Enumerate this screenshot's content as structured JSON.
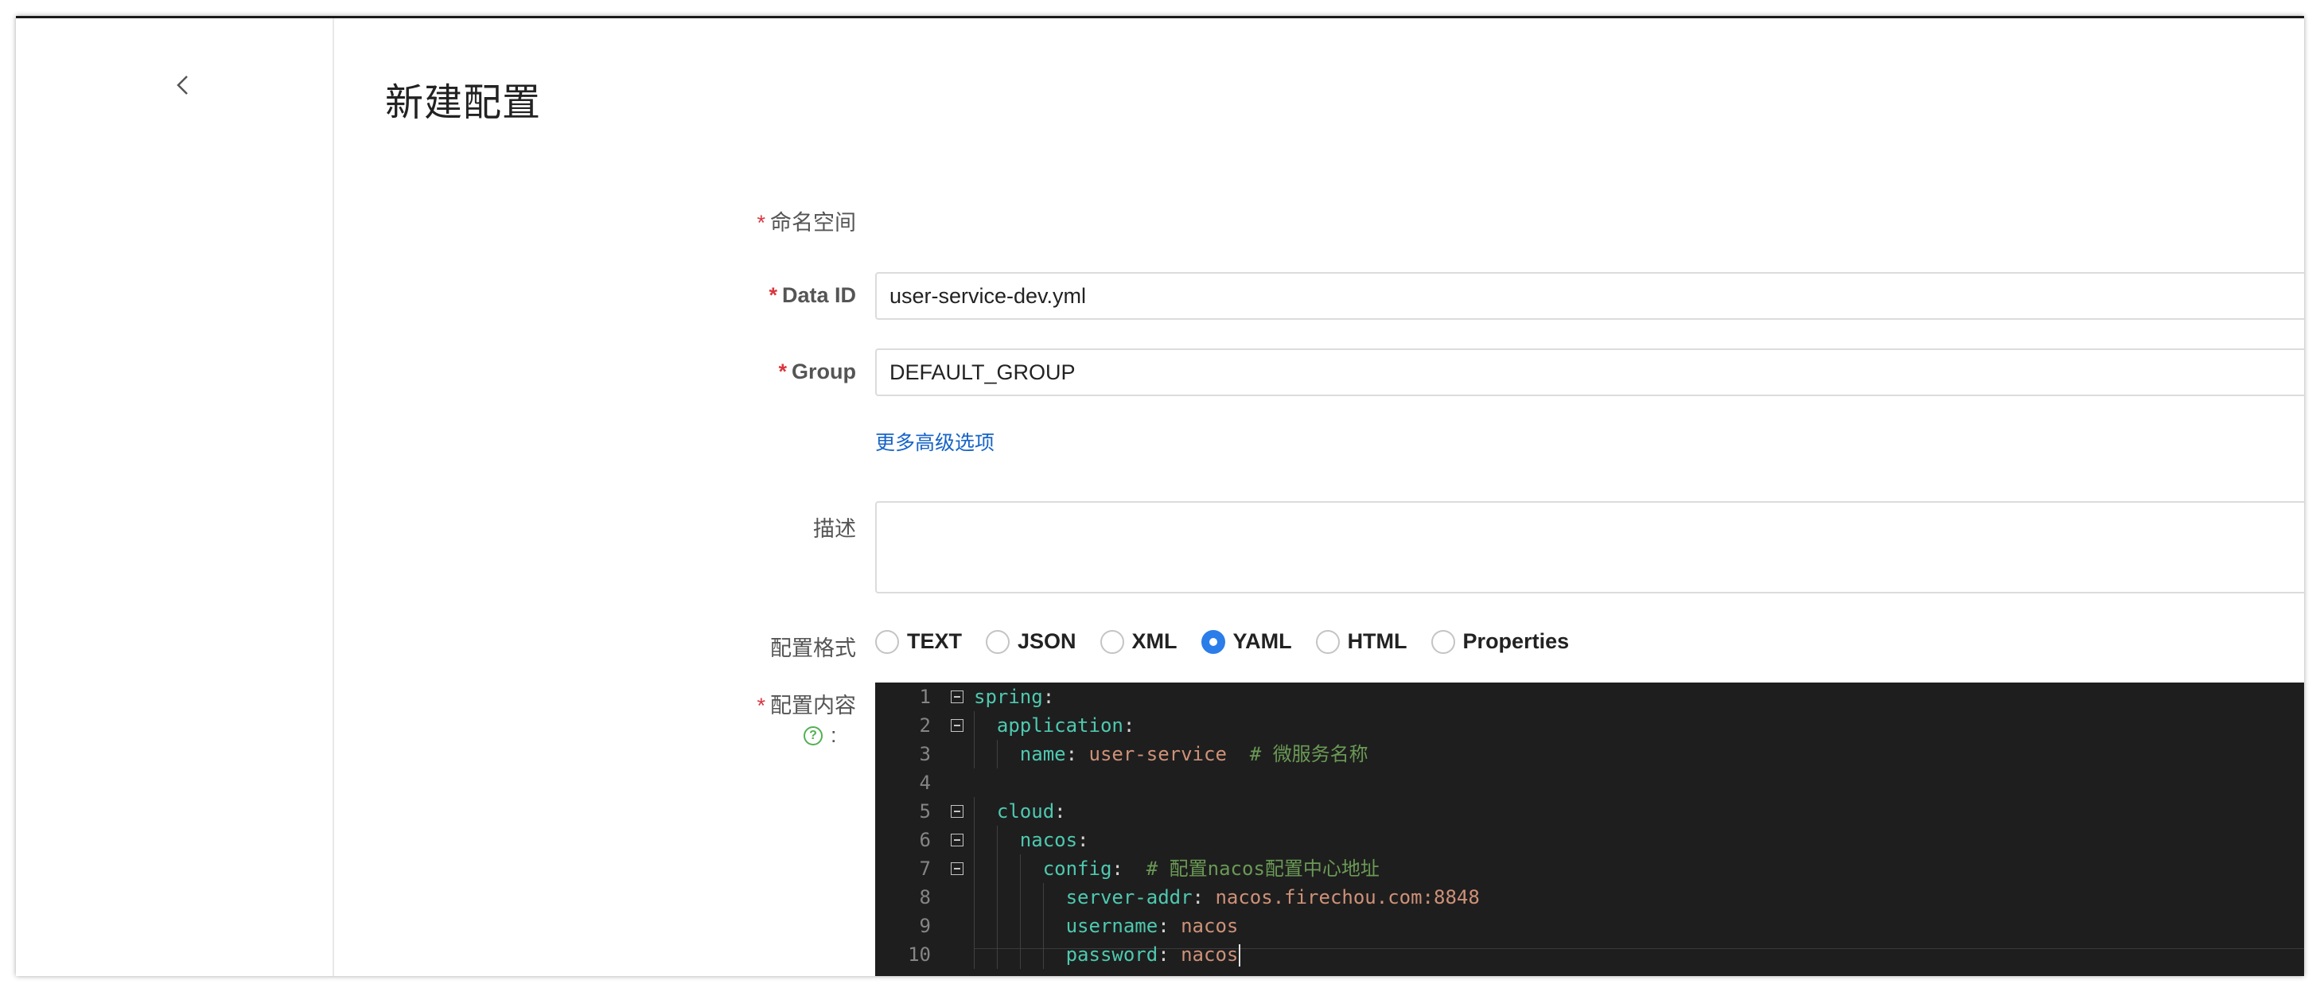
{
  "sidebar": {
    "back_icon": "chevron-left-icon"
  },
  "page": {
    "title": "新建配置"
  },
  "form": {
    "namespace": {
      "label": "命名空间",
      "required": "*"
    },
    "data_id": {
      "label": "Data ID",
      "required": "*",
      "value": "user-service-dev.yml"
    },
    "group": {
      "label": "Group",
      "required": "*",
      "value": "DEFAULT_GROUP",
      "clear_icon": "clear-circle-icon"
    },
    "advanced_link": "更多高级选项",
    "description": {
      "label": "描述",
      "value": ""
    },
    "format": {
      "label": "配置格式",
      "options": [
        "TEXT",
        "JSON",
        "XML",
        "YAML",
        "HTML",
        "Properties"
      ],
      "selected": "YAML"
    },
    "content": {
      "label": "配置内容",
      "required": "*",
      "help_icon": "?",
      "colon": ":"
    }
  },
  "editor": {
    "lines": [
      {
        "n": "1",
        "fold": true,
        "key": "spring",
        "sep": ":",
        "value": "",
        "comment": ""
      },
      {
        "n": "2",
        "fold": true,
        "indent": "  ",
        "key": "application",
        "sep": ":",
        "value": "",
        "comment": ""
      },
      {
        "n": "3",
        "fold": false,
        "indent": "    ",
        "key": "name",
        "sep": ": ",
        "value": "user-service",
        "comment": "  # 微服务名称"
      },
      {
        "n": "4",
        "fold": false,
        "indent": "",
        "key": "",
        "sep": "",
        "value": "",
        "comment": ""
      },
      {
        "n": "5",
        "fold": true,
        "indent": "  ",
        "key": "cloud",
        "sep": ":",
        "value": "",
        "comment": ""
      },
      {
        "n": "6",
        "fold": true,
        "indent": "    ",
        "key": "nacos",
        "sep": ":",
        "value": "",
        "comment": ""
      },
      {
        "n": "7",
        "fold": true,
        "indent": "      ",
        "key": "config",
        "sep": ":",
        "value": "",
        "comment": "  # 配置nacos配置中心地址"
      },
      {
        "n": "8",
        "fold": false,
        "indent": "        ",
        "key": "server-addr",
        "sep": ": ",
        "value": "nacos.firechou.com:8848",
        "comment": ""
      },
      {
        "n": "9",
        "fold": false,
        "indent": "        ",
        "key": "username",
        "sep": ": ",
        "value": "nacos",
        "comment": ""
      },
      {
        "n": "10",
        "fold": false,
        "indent": "        ",
        "key": "password",
        "sep": ": ",
        "value": "nacos",
        "comment": ""
      }
    ]
  },
  "colors": {
    "accent": "#2b7de9",
    "link": "#1764c8",
    "required": "#d9363e",
    "editor_bg": "#1e1e1e",
    "yaml_key": "#4ec9b0",
    "yaml_value": "#ce9178",
    "yaml_comment": "#6a9955"
  }
}
